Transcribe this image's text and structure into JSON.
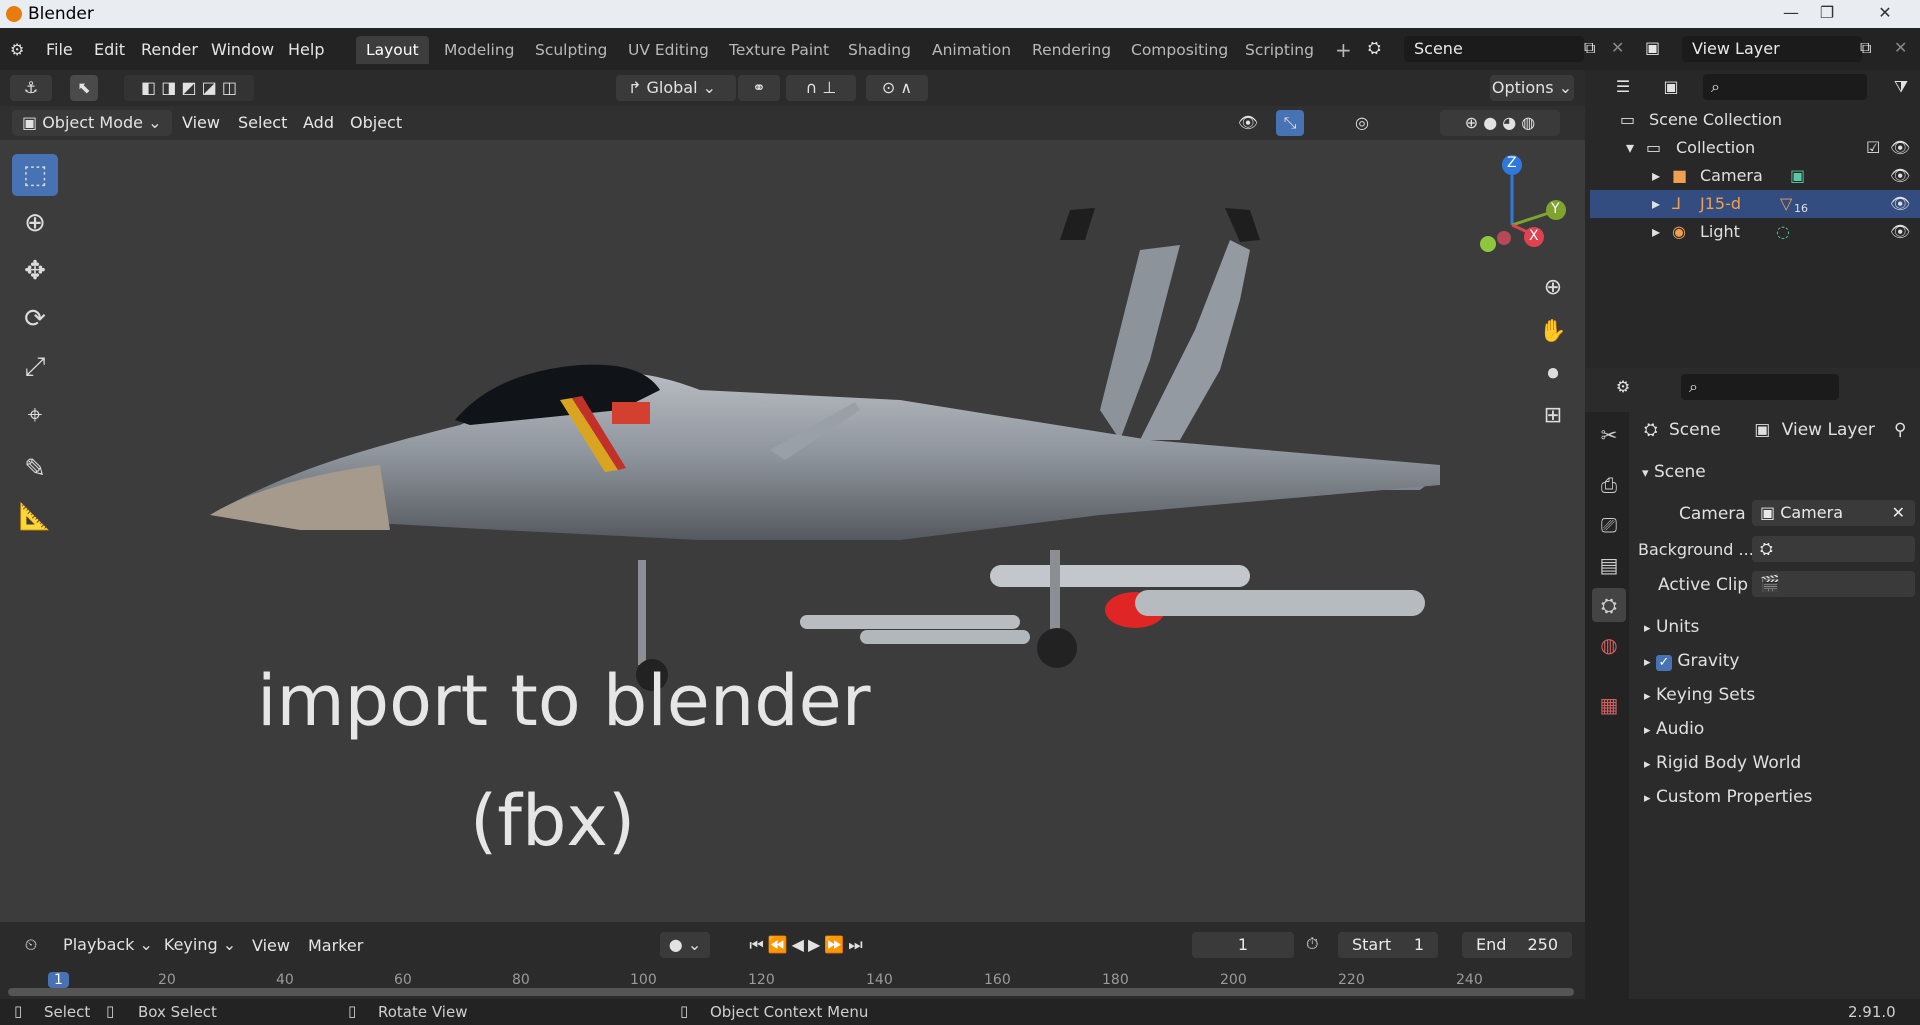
{
  "window": {
    "title": "Blender",
    "controls": [
      "—",
      "❐",
      "✕"
    ]
  },
  "topmenu": [
    "File",
    "Edit",
    "Render",
    "Window",
    "Help"
  ],
  "workspaces": [
    "Layout",
    "Modeling",
    "Sculpting",
    "UV Editing",
    "Texture Paint",
    "Shading",
    "Animation",
    "Rendering",
    "Compositing",
    "Scripting"
  ],
  "scene_field": "Scene",
  "view_layer_field": "View Layer",
  "toolbar_row": {
    "orientation": "Global",
    "options": "Options"
  },
  "header2": {
    "mode": "Object Mode",
    "menus": [
      "View",
      "Select",
      "Add",
      "Object"
    ]
  },
  "overlay_text": {
    "line1": "import to blender",
    "line2": "(fbx)"
  },
  "gizmo": {
    "z": "Z",
    "y": "Y",
    "x": "X"
  },
  "outliner": {
    "root": "Scene Collection",
    "collection": "Collection",
    "items": [
      {
        "name": "Camera",
        "selected": false
      },
      {
        "name": "J15-d",
        "selected": true,
        "badge": "16"
      },
      {
        "name": "Light",
        "selected": false
      }
    ]
  },
  "properties": {
    "breadcrumb": [
      "Scene",
      "View Layer"
    ],
    "panel_title": "Scene",
    "camera_label": "Camera",
    "camera_value": "Camera",
    "background_label": "Background ...",
    "active_clip_label": "Active Clip",
    "sections": [
      "Units",
      "Gravity",
      "Keying Sets",
      "Audio",
      "Rigid Body World",
      "Custom Properties"
    ],
    "gravity_checked": true
  },
  "timeline": {
    "menus": [
      "Playback",
      "Keying",
      "View",
      "Marker"
    ],
    "current_frame": "1",
    "start_label": "Start",
    "start": "1",
    "end_label": "End",
    "end": "250",
    "ruler": [
      "1",
      "20",
      "40",
      "60",
      "80",
      "100",
      "120",
      "140",
      "160",
      "180",
      "200",
      "220",
      "240"
    ]
  },
  "status": {
    "select": "Select",
    "box_select": "Box Select",
    "rotate": "Rotate View",
    "context": "Object Context Menu",
    "version": "2.91.0"
  }
}
